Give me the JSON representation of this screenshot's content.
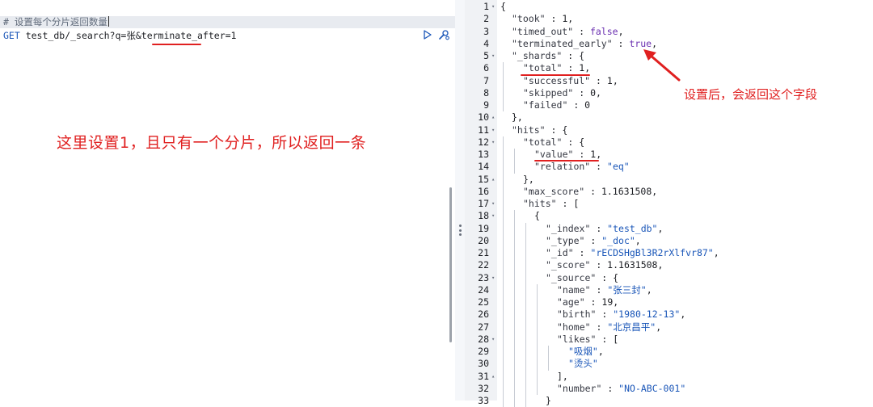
{
  "request": {
    "comment": "# 设置每个分片返回数量",
    "method": "GET",
    "path_prefix": " test_db/_search?q=张&",
    "path_highlight": "terminate_after=1",
    "run_icon": "play-icon",
    "settings_icon": "wrench-icon"
  },
  "annotations": {
    "left": "这里设置1，且只有一个分片，所以返回一条",
    "right": "设置后，会返回这个字段"
  },
  "colors": {
    "annotation_red": "#e02020",
    "string_blue": "#1a56b8",
    "keyword_purple": "#6a2fb0"
  },
  "response": {
    "lines": [
      {
        "n": "1",
        "fold": "▾",
        "depth": 0,
        "parts": [
          {
            "t": "{",
            "c": "punc"
          }
        ]
      },
      {
        "n": "2",
        "fold": "",
        "depth": 1,
        "parts": [
          {
            "t": "\"took\"",
            "c": "key"
          },
          {
            "t": " : ",
            "c": "punc"
          },
          {
            "t": "1",
            "c": "num"
          },
          {
            "t": ",",
            "c": "punc"
          }
        ]
      },
      {
        "n": "3",
        "fold": "",
        "depth": 1,
        "parts": [
          {
            "t": "\"timed_out\"",
            "c": "key"
          },
          {
            "t": " : ",
            "c": "punc"
          },
          {
            "t": "false",
            "c": "kw"
          },
          {
            "t": ",",
            "c": "punc"
          }
        ]
      },
      {
        "n": "4",
        "fold": "",
        "depth": 1,
        "parts": [
          {
            "t": "\"terminated_early\"",
            "c": "key"
          },
          {
            "t": " : ",
            "c": "punc"
          },
          {
            "t": "true",
            "c": "kw"
          },
          {
            "t": ",",
            "c": "punc"
          }
        ]
      },
      {
        "n": "5",
        "fold": "▾",
        "depth": 1,
        "parts": [
          {
            "t": "\"_shards\"",
            "c": "key"
          },
          {
            "t": " : {",
            "c": "punc"
          }
        ]
      },
      {
        "n": "6",
        "fold": "",
        "depth": 2,
        "parts": [
          {
            "t": "\"total\"",
            "c": "key"
          },
          {
            "t": " : ",
            "c": "punc"
          },
          {
            "t": "1",
            "c": "num"
          },
          {
            "t": ",",
            "c": "punc"
          }
        ]
      },
      {
        "n": "7",
        "fold": "",
        "depth": 2,
        "parts": [
          {
            "t": "\"successful\"",
            "c": "key"
          },
          {
            "t": " : ",
            "c": "punc"
          },
          {
            "t": "1",
            "c": "num"
          },
          {
            "t": ",",
            "c": "punc"
          }
        ]
      },
      {
        "n": "8",
        "fold": "",
        "depth": 2,
        "parts": [
          {
            "t": "\"skipped\"",
            "c": "key"
          },
          {
            "t": " : ",
            "c": "punc"
          },
          {
            "t": "0",
            "c": "num"
          },
          {
            "t": ",",
            "c": "punc"
          }
        ]
      },
      {
        "n": "9",
        "fold": "",
        "depth": 2,
        "parts": [
          {
            "t": "\"failed\"",
            "c": "key"
          },
          {
            "t": " : ",
            "c": "punc"
          },
          {
            "t": "0",
            "c": "num"
          }
        ]
      },
      {
        "n": "10",
        "fold": "▴",
        "depth": 1,
        "parts": [
          {
            "t": "},",
            "c": "punc"
          }
        ]
      },
      {
        "n": "11",
        "fold": "▾",
        "depth": 1,
        "parts": [
          {
            "t": "\"hits\"",
            "c": "key"
          },
          {
            "t": " : {",
            "c": "punc"
          }
        ]
      },
      {
        "n": "12",
        "fold": "▾",
        "depth": 2,
        "parts": [
          {
            "t": "\"total\"",
            "c": "key"
          },
          {
            "t": " : {",
            "c": "punc"
          }
        ]
      },
      {
        "n": "13",
        "fold": "",
        "depth": 3,
        "parts": [
          {
            "t": "\"value\"",
            "c": "key"
          },
          {
            "t": " : ",
            "c": "punc"
          },
          {
            "t": "1",
            "c": "num"
          },
          {
            "t": ",",
            "c": "punc"
          }
        ]
      },
      {
        "n": "14",
        "fold": "",
        "depth": 3,
        "parts": [
          {
            "t": "\"relation\"",
            "c": "key"
          },
          {
            "t": " : ",
            "c": "punc"
          },
          {
            "t": "\"eq\"",
            "c": "str"
          }
        ]
      },
      {
        "n": "15",
        "fold": "▴",
        "depth": 2,
        "parts": [
          {
            "t": "},",
            "c": "punc"
          }
        ]
      },
      {
        "n": "16",
        "fold": "",
        "depth": 2,
        "parts": [
          {
            "t": "\"max_score\"",
            "c": "key"
          },
          {
            "t": " : ",
            "c": "punc"
          },
          {
            "t": "1.1631508",
            "c": "num"
          },
          {
            "t": ",",
            "c": "punc"
          }
        ]
      },
      {
        "n": "17",
        "fold": "▾",
        "depth": 2,
        "parts": [
          {
            "t": "\"hits\"",
            "c": "key"
          },
          {
            "t": " : [",
            "c": "punc"
          }
        ]
      },
      {
        "n": "18",
        "fold": "▾",
        "depth": 3,
        "parts": [
          {
            "t": "{",
            "c": "punc"
          }
        ]
      },
      {
        "n": "19",
        "fold": "",
        "depth": 4,
        "parts": [
          {
            "t": "\"_index\"",
            "c": "key"
          },
          {
            "t": " : ",
            "c": "punc"
          },
          {
            "t": "\"test_db\"",
            "c": "str"
          },
          {
            "t": ",",
            "c": "punc"
          }
        ]
      },
      {
        "n": "20",
        "fold": "",
        "depth": 4,
        "parts": [
          {
            "t": "\"_type\"",
            "c": "key"
          },
          {
            "t": " : ",
            "c": "punc"
          },
          {
            "t": "\"_doc\"",
            "c": "str"
          },
          {
            "t": ",",
            "c": "punc"
          }
        ]
      },
      {
        "n": "21",
        "fold": "",
        "depth": 4,
        "parts": [
          {
            "t": "\"_id\"",
            "c": "key"
          },
          {
            "t": " : ",
            "c": "punc"
          },
          {
            "t": "\"rECDSHgBl3R2rXlfvr87\"",
            "c": "str"
          },
          {
            "t": ",",
            "c": "punc"
          }
        ]
      },
      {
        "n": "22",
        "fold": "",
        "depth": 4,
        "parts": [
          {
            "t": "\"_score\"",
            "c": "key"
          },
          {
            "t": " : ",
            "c": "punc"
          },
          {
            "t": "1.1631508",
            "c": "num"
          },
          {
            "t": ",",
            "c": "punc"
          }
        ]
      },
      {
        "n": "23",
        "fold": "▾",
        "depth": 4,
        "parts": [
          {
            "t": "\"_source\"",
            "c": "key"
          },
          {
            "t": " : {",
            "c": "punc"
          }
        ]
      },
      {
        "n": "24",
        "fold": "",
        "depth": 5,
        "parts": [
          {
            "t": "\"name\"",
            "c": "key"
          },
          {
            "t": " : ",
            "c": "punc"
          },
          {
            "t": "\"张三封\"",
            "c": "str"
          },
          {
            "t": ",",
            "c": "punc"
          }
        ]
      },
      {
        "n": "25",
        "fold": "",
        "depth": 5,
        "parts": [
          {
            "t": "\"age\"",
            "c": "key"
          },
          {
            "t": " : ",
            "c": "punc"
          },
          {
            "t": "19",
            "c": "num"
          },
          {
            "t": ",",
            "c": "punc"
          }
        ]
      },
      {
        "n": "26",
        "fold": "",
        "depth": 5,
        "parts": [
          {
            "t": "\"birth\"",
            "c": "key"
          },
          {
            "t": " : ",
            "c": "punc"
          },
          {
            "t": "\"1980-12-13\"",
            "c": "str"
          },
          {
            "t": ",",
            "c": "punc"
          }
        ]
      },
      {
        "n": "27",
        "fold": "",
        "depth": 5,
        "parts": [
          {
            "t": "\"home\"",
            "c": "key"
          },
          {
            "t": " : ",
            "c": "punc"
          },
          {
            "t": "\"北京昌平\"",
            "c": "str"
          },
          {
            "t": ",",
            "c": "punc"
          }
        ]
      },
      {
        "n": "28",
        "fold": "▾",
        "depth": 5,
        "parts": [
          {
            "t": "\"likes\"",
            "c": "key"
          },
          {
            "t": " : [",
            "c": "punc"
          }
        ]
      },
      {
        "n": "29",
        "fold": "",
        "depth": 6,
        "parts": [
          {
            "t": "\"吸烟\"",
            "c": "str"
          },
          {
            "t": ",",
            "c": "punc"
          }
        ]
      },
      {
        "n": "30",
        "fold": "",
        "depth": 6,
        "parts": [
          {
            "t": "\"烫头\"",
            "c": "str"
          }
        ]
      },
      {
        "n": "31",
        "fold": "▴",
        "depth": 5,
        "parts": [
          {
            "t": "],",
            "c": "punc"
          }
        ]
      },
      {
        "n": "32",
        "fold": "",
        "depth": 5,
        "parts": [
          {
            "t": "\"number\"",
            "c": "key"
          },
          {
            "t": " : ",
            "c": "punc"
          },
          {
            "t": "\"NO-ABC-001\"",
            "c": "str"
          }
        ]
      },
      {
        "n": "33",
        "fold": "",
        "depth": 4,
        "parts": [
          {
            "t": "}",
            "c": "punc"
          }
        ]
      }
    ]
  }
}
